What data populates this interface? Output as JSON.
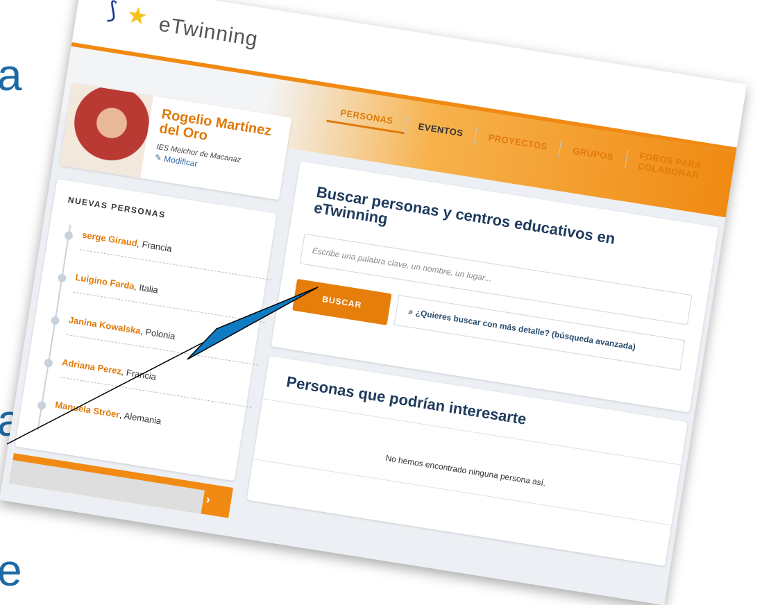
{
  "slide": {
    "letters": [
      "a",
      "a",
      "e"
    ]
  },
  "brand": {
    "logo_word": "eTwinning"
  },
  "nav": {
    "items": [
      {
        "label": "PERSONAS",
        "active": true
      },
      {
        "label": "EVENTOS",
        "active": false
      },
      {
        "label": "PROYECTOS",
        "active": false
      },
      {
        "label": "GRUPOS",
        "active": false
      },
      {
        "label": "FOROS PARA COLABORAR",
        "active": false
      }
    ]
  },
  "profile": {
    "name": "Rogelio Martínez del Oro",
    "school": "IES Melchor de Macanaz",
    "edit_label": "Modificar",
    "edit_icon": "pencil-icon"
  },
  "new_people": {
    "title": "NUEVAS PERSONAS",
    "items": [
      {
        "name": "serge Giraud",
        "country": "Francia"
      },
      {
        "name": "Luigino Farda",
        "country": "Italia"
      },
      {
        "name": "Janina Kowalska",
        "country": "Polonia"
      },
      {
        "name": "Adriana Perez",
        "country": "Francia"
      },
      {
        "name": "Manuela Ströer",
        "country": "Alemania"
      }
    ],
    "footer_icon": "chevron-right-icon"
  },
  "search": {
    "title": "Buscar personas y centros educativos en eTwinning",
    "placeholder": "Escribe una palabra clave, un nombre, un lugar...",
    "button_label": "BUSCAR",
    "advanced_link": "¿Quieres buscar con más detalle? (búsqueda avanzada)",
    "advanced_icon": "search-icon"
  },
  "suggestions": {
    "title": "Personas que podrían interesarte",
    "empty_text": "No hemos encontrado ninguna persona así."
  },
  "colors": {
    "accent": "#e67e0c",
    "heading": "#1f3b5c",
    "arrow_fill": "#0f7cc1"
  }
}
